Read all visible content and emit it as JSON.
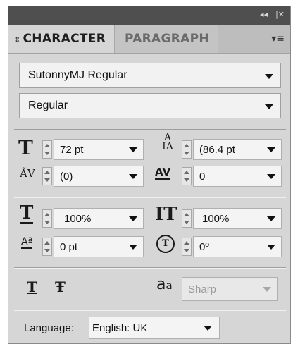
{
  "titlebar": {
    "collapse_glyph": "◂◂",
    "close_glyph": "|✕"
  },
  "tabs": [
    {
      "label": "CHARACTER",
      "active": true,
      "glyph": "⇕"
    },
    {
      "label": "PARAGRAPH",
      "active": false
    }
  ],
  "panel_menu_glyph": "▾≡",
  "font_family": {
    "value": "SutonnyMJ Regular"
  },
  "font_style": {
    "value": "Regular"
  },
  "font_size": {
    "value": "72 pt",
    "icon": "font-size-icon"
  },
  "leading": {
    "value": "(86.4 pt",
    "icon": "leading-icon"
  },
  "kerning": {
    "value": "(0)",
    "icon": "kerning-icon"
  },
  "tracking": {
    "value": "0",
    "icon": "tracking-icon"
  },
  "horizontal_scale": {
    "value": "100%",
    "icon": "horizontal-scale-icon"
  },
  "vertical_scale": {
    "value": "100%",
    "icon": "vertical-scale-icon"
  },
  "baseline_shift": {
    "value": "0 pt",
    "icon": "baseline-shift-icon"
  },
  "character_rotation": {
    "value": "0º",
    "icon": "rotation-icon"
  },
  "text_decoration": {
    "underline_glyph": "T",
    "strikethrough_glyph": "Ŧ"
  },
  "anti_aliasing": {
    "glyph": "a",
    "glyph_sub": "a",
    "value": "Sharp"
  },
  "language": {
    "label": "Language:",
    "value": "English: UK"
  }
}
